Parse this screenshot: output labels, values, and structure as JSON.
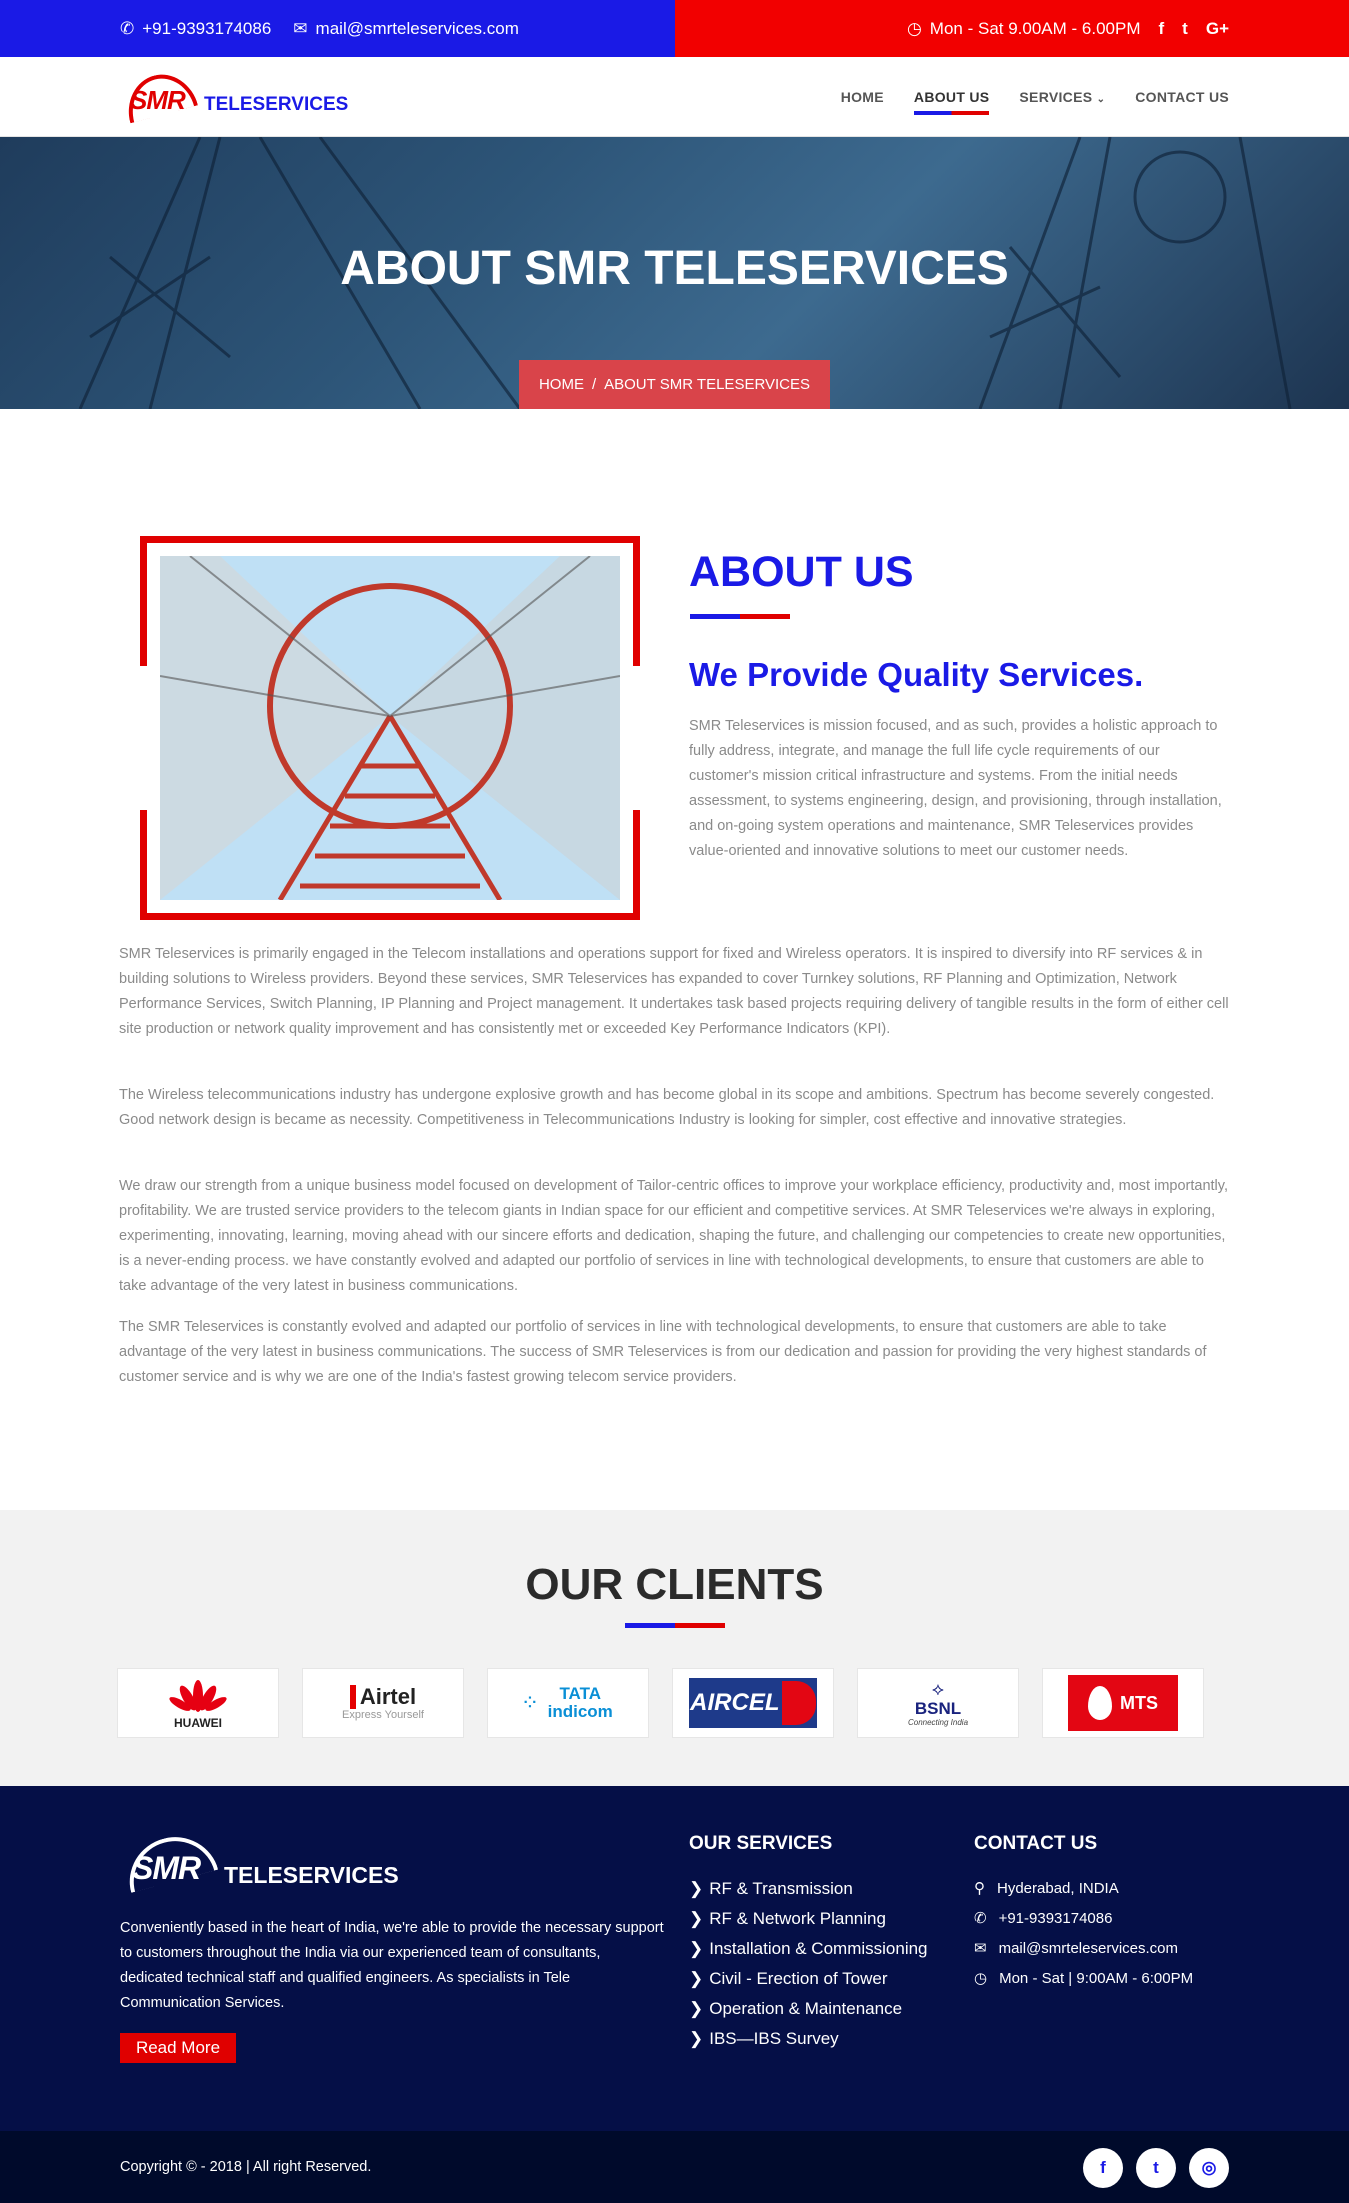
{
  "topbar": {
    "phone": "+91-9393174086",
    "email": "mail@smrteleservices.com",
    "hours": "Mon - Sat 9.00AM - 6.00PM",
    "social": [
      "f",
      "t",
      "G+"
    ]
  },
  "header": {
    "logo_smr": "SMR",
    "logo_tele": "TELESERVICES",
    "nav": [
      "HOME",
      "ABOUT US",
      "SERVICES",
      "CONTACT US"
    ]
  },
  "hero": {
    "title": "ABOUT SMR TELESERVICES",
    "crumb_home": "HOME",
    "crumb_sep": "/",
    "crumb_current": "ABOUT SMR TELESERVICES"
  },
  "about": {
    "title": "ABOUT US",
    "subtitle": "We Provide Quality Services.",
    "intro": "SMR Teleservices is mission focused, and as such, provides a holistic approach to fully address, integrate, and manage the full life cycle requirements of our customer's mission critical infrastructure and systems. From the initial needs assessment, to systems engineering, design, and provisioning, through installation, and on-going system operations and maintenance, SMR Teleservices provides value-oriented and innovative solutions to meet our customer needs.",
    "p1": "SMR Teleservices is primarily engaged in the Telecom installations and operations support for fixed and Wireless operators. It is inspired to diversify into RF services & in building solutions to Wireless providers. Beyond these services, SMR Teleservices has expanded to cover Turnkey solutions, RF Planning and Optimization, Network Performance Services, Switch Planning, IP Planning and Project management. It undertakes task based projects requiring delivery of tangible results in the form of either cell site production or network quality improvement and has consistently met or exceeded Key Performance Indicators (KPI).",
    "p2": "The Wireless telecommunications industry has undergone explosive growth and has become global in its scope and ambitions. Spectrum has become severely congested. Good network design is became as necessity. Competitiveness in Telecommunications Industry is looking for simpler, cost effective and innovative strategies.",
    "p3": "We draw our strength from a unique business model focused on development of Tailor-centric offices to improve your workplace efficiency, productivity and, most importantly, profitability. We are trusted service providers to the telecom giants in Indian space for our efficient and competitive services. At SMR Teleservices we're always in exploring, experimenting, innovating, learning, moving ahead with our sincere efforts and dedication, shaping the future, and challenging our competencies to create new opportunities, is a never-ending process. we have constantly evolved and adapted our portfolio of services in line with technological developments, to ensure that customers are able to take advantage of the very latest in business communications.",
    "p4": "The SMR Teleservices is constantly evolved and adapted our portfolio of services in line with technological developments, to ensure that customers are able to take advantage of the very latest in business communications. The success of SMR Teleservices is from our dedication and passion for providing the very highest standards of customer service and is why we are one of the India's fastest growing telecom service providers."
  },
  "clients": {
    "title": "OUR CLIENTS",
    "logos": [
      {
        "name": "HUAWEI",
        "color": "#e60012"
      },
      {
        "name": "Airtel",
        "sub": "Express Yourself",
        "color": "#e40000"
      },
      {
        "name": "TATA indicom",
        "color": "#0a8fd6"
      },
      {
        "name": "AIRCEL",
        "color": "#1e3a8a"
      },
      {
        "name": "BSNL",
        "sub": "Connecting India",
        "color": "#1a237e"
      },
      {
        "name": "MTS",
        "color": "#e30613"
      }
    ]
  },
  "footer": {
    "logo_smr": "SMR",
    "logo_tele": "TELESERVICES",
    "about": "Conveniently based in the heart of India, we're able to provide the necessary support to customers throughout the India via our experienced team of consultants, dedicated technical staff and qualified engineers. As specialists in Tele Communication Services.",
    "read_more": "Read More",
    "services_title": "OUR SERVICES",
    "services": [
      "RF & Transmission",
      "RF & Network Planning",
      "Installation & Commissioning",
      "Civil - Erection of Tower",
      "Operation & Maintenance",
      "IBS—IBS Survey"
    ],
    "contact_title": "CONTACT US",
    "contact": [
      "Hyderabad, INDIA",
      "+91-9393174086",
      "mail@smrteleservices.com",
      "Mon - Sat | 9:00AM - 6:00PM"
    ],
    "copyright": "Copyright © - 2018 | All right Reserved."
  },
  "colors": {
    "brand_blue": "#1a1ae6",
    "brand_red": "#e00000",
    "footer_bg": "#050f47"
  }
}
